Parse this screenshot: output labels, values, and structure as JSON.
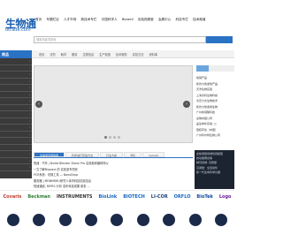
{
  "header": {
    "logo_text": "生物通",
    "logo_sub": "otrade.com",
    "nav": [
      "首页",
      "专题栏目",
      "人才市场",
      "新技术专栏",
      "中国科学人",
      "Biowell",
      "实验视频室",
      "会展中心",
      "科技专栏",
      "技术频道"
    ]
  },
  "search": {
    "placeholder": "搜索关键词查询"
  },
  "sidebar": {
    "title": "商品",
    "rows": [
      "",
      "",
      "",
      "",
      "",
      "",
      "",
      "",
      "",
      "",
      "",
      "",
      "",
      "",
      "",
      "",
      ""
    ]
  },
  "subnav": [
    "首页",
    "试剂",
    "耗材",
    "服务",
    "生物信息",
    "生产制造",
    "技术服务",
    "实验方法",
    "资料库"
  ],
  "right_panel": {
    "tabs": [
      "",
      "",
      ""
    ],
    "items": [
      "热销产品",
      "新款力攻发球产品",
      "天津生物实验",
      "上海杰科生物科技",
      "北京力文生物技术",
      "新款力攻发球生物",
      "广州新辣酸科技",
      "采购时报公司",
      "盖生体外实验, 公",
      "蛋核有氧（中国）",
      "广州科尔特生物公司"
    ]
  },
  "bottom_tabs": [
    "生物通专题简报",
    "科学进行实验方法",
    "行业方案",
    "专利",
    "Cellular"
  ],
  "news": [
    "快速 · 汽车 | Bullet Blender Storm Pro 高效能研磨碎样仪",
    "一文了解Biozone 的 实验室专项资",
    "PCR系统：切换工具 — NanoDrop",
    "服务器 | MDBMRW-I研究人体内科技前线信息",
    "快速通道, MIFRS 分析 发布科技成果 新发 ..."
  ],
  "dark_banner": [
    "虚拟测量领域仿真模型",
    "的功能概念等",
    "制剂领域: 高质量",
    "高通量：全自动化",
    "新一代生命科学仪器"
  ],
  "brands": [
    "Covaris",
    "Beckman",
    "INSTRUMENTS",
    "BioLink",
    "BIOTECH",
    "LI-COR",
    "ORFLO",
    "BioTek",
    "Logo"
  ]
}
